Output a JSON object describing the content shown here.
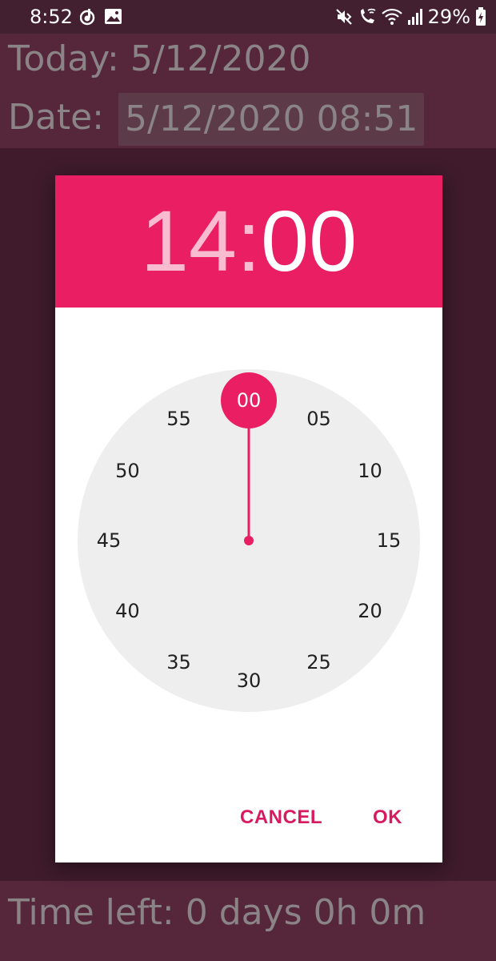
{
  "status_bar": {
    "time": "8:52",
    "battery": "29%",
    "icons": [
      "music-sync-icon",
      "image-icon",
      "mute-icon",
      "wifi-call-icon",
      "wifi-icon",
      "signal-icon",
      "battery-charging-icon"
    ]
  },
  "app": {
    "today_label": "Today: ",
    "today_value": "5/12/2020",
    "date_label": "Date: ",
    "date_value": "5/12/2020 08:51",
    "time_left": "Time left: 0 days 0h 0m"
  },
  "dialog": {
    "header": {
      "hour": "14",
      "separator": ":",
      "minute": "00"
    },
    "clock": {
      "mode": "minutes",
      "numbers": [
        "00",
        "05",
        "10",
        "15",
        "20",
        "25",
        "30",
        "35",
        "40",
        "45",
        "50",
        "55"
      ],
      "selected": "00"
    },
    "actions": {
      "cancel_label": "CANCEL",
      "ok_label": "OK"
    }
  },
  "colors": {
    "accent": "#e91e63",
    "accent_text": "#d81b60",
    "background": "#3f1b2b",
    "app_bar": "#56263b",
    "clock_face": "#eeeeee"
  }
}
